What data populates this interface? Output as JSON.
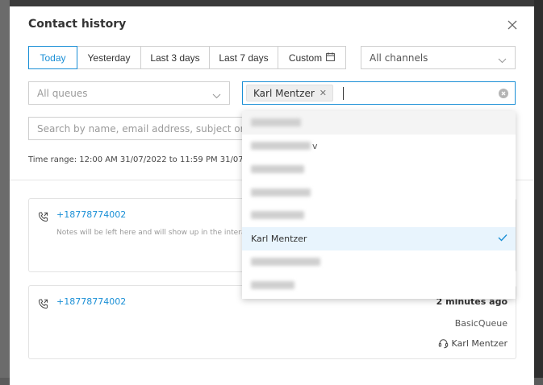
{
  "modal": {
    "title": "Contact history"
  },
  "date_range": {
    "buttons": [
      {
        "label": "Today",
        "active": true
      },
      {
        "label": "Yesterday",
        "active": false
      },
      {
        "label": "Last 3 days",
        "active": false
      },
      {
        "label": "Last 7 days",
        "active": false
      },
      {
        "label": "Custom",
        "active": false
      }
    ]
  },
  "filters": {
    "channels_value": "All channels",
    "queues_placeholder": "All queues",
    "agent_chip": "Karl Mentzer",
    "search_placeholder": "Search by name, email address, subject or phone"
  },
  "time_range_text": "Time range: 12:00 AM 31/07/2022 to 11:59 PM 31/07/2022",
  "contacts": [
    {
      "phone": "+18778774002",
      "note": "Notes will be left here and will show up in the intera"
    },
    {
      "phone": "+18778774002",
      "time_ago": "2 minutes ago",
      "queue": "BasicQueue",
      "agent": "Karl Mentzer"
    }
  ],
  "dropdown": {
    "items": [
      {
        "blurred": true
      },
      {
        "blurred": true,
        "suffix": "v"
      },
      {
        "blurred": true
      },
      {
        "blurred": true
      },
      {
        "blurred": true
      },
      {
        "label": "Karl Mentzer",
        "selected": true
      },
      {
        "blurred": true
      },
      {
        "blurred": true
      }
    ]
  },
  "colors": {
    "accent": "#1a8fd6",
    "selected_bg": "#e8f4fd"
  }
}
